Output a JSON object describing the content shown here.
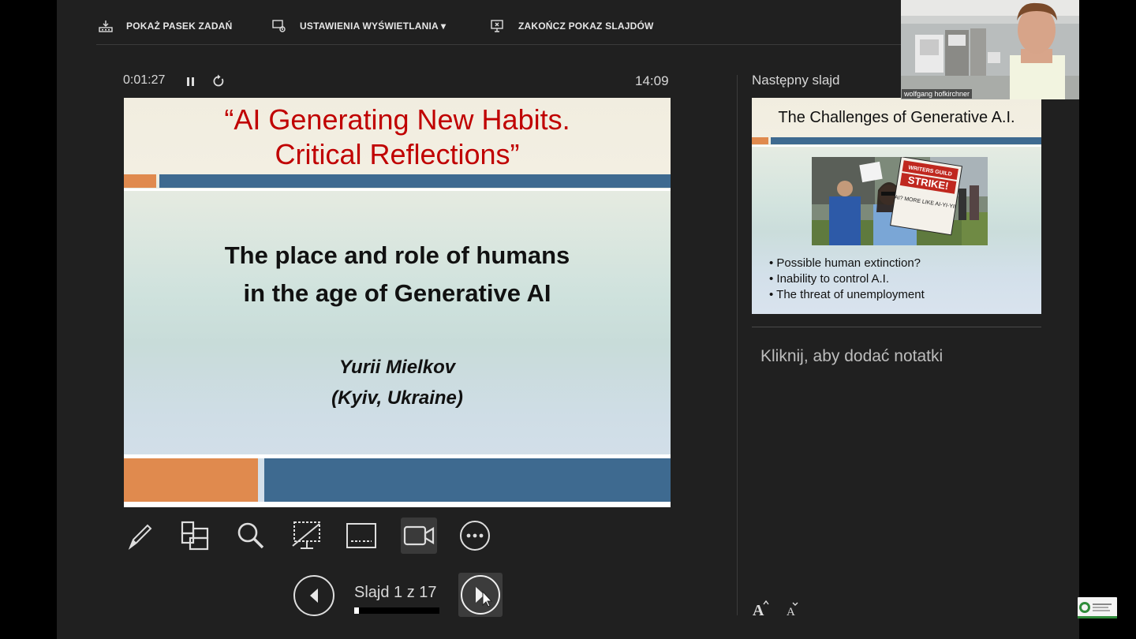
{
  "toolbar": {
    "taskbar_label": "POKAŻ PASEK ZADAŃ",
    "display_label": "USTAWIENIA WYŚWIETLANIA ▾",
    "end_label": "ZAKOŃCZ POKAZ SLAJDÓW"
  },
  "timer": {
    "elapsed": "0:01:27",
    "clock": "14:09"
  },
  "current_slide": {
    "title_line1": "“AI Generating New Habits.",
    "title_line2": "Critical Reflections”",
    "subtitle_line1": "The place and role of humans",
    "subtitle_line2": "in the age of Generative AI",
    "author_line1": "Yurii Mielkov",
    "author_line2": "(Kyiv, Ukraine)"
  },
  "tools": [
    "pen-icon",
    "all-slides-icon",
    "zoom-icon",
    "black-screen-icon",
    "subtitles-icon",
    "camera-icon",
    "more-options-icon"
  ],
  "navigation": {
    "counter": "Slajd 1 z 17",
    "progress_fraction": 0.06
  },
  "next_slide": {
    "heading": "Następny slajd",
    "title": "The Challenges of Generative A.I.",
    "photo_sign_line1": "WRITERS GUILD",
    "photo_sign_line2": "STRIKE!",
    "photo_sign_line3": "AI? MORE LIKE AI-YI-YI!",
    "bullets": [
      "Possible human extinction?",
      "Inability to control A.I.",
      "The threat of unemployment"
    ]
  },
  "notes": {
    "placeholder": "Kliknij, aby dodać notatki"
  },
  "webcam": {
    "name": "wolfgang hofkirchner"
  },
  "colors": {
    "background": "#202020",
    "title_red": "#c00000",
    "orange": "#e08a4e",
    "blue": "#3e6a90"
  }
}
